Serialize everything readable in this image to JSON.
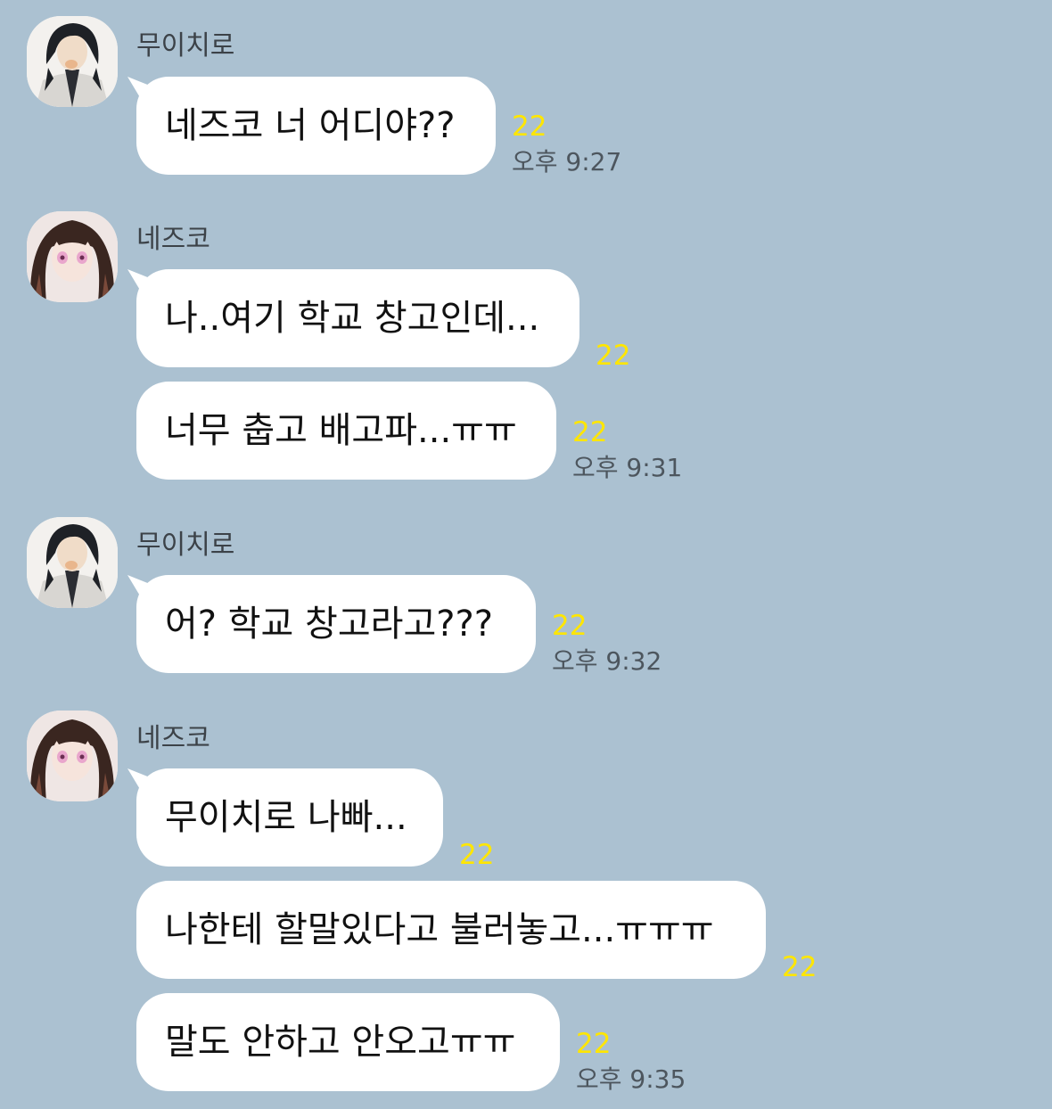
{
  "theme": {
    "background": "#abc1d1",
    "bubble": "#ffffff",
    "unread_color": "#ffe600",
    "meta_text": "#4d565e"
  },
  "groups": [
    {
      "sender": "무이치로",
      "avatar_icon": "muichiro-avatar-icon",
      "messages": [
        {
          "text": "네즈코 너 어디야??",
          "unread": "22",
          "time": "오후 9:27"
        }
      ]
    },
    {
      "sender": "네즈코",
      "avatar_icon": "nezuko-avatar-icon",
      "messages": [
        {
          "text": "나..여기 학교 창고인데...",
          "unread": "22"
        },
        {
          "text": "너무 춥고 배고파...ㅠㅠ",
          "unread": "22",
          "time": "오후 9:31"
        }
      ]
    },
    {
      "sender": "무이치로",
      "avatar_icon": "muichiro-avatar-icon",
      "messages": [
        {
          "text": "어? 학교 창고라고???",
          "unread": "22",
          "time": "오후 9:32"
        }
      ]
    },
    {
      "sender": "네즈코",
      "avatar_icon": "nezuko-avatar-icon",
      "messages": [
        {
          "text": "무이치로 나빠...",
          "unread": "22"
        },
        {
          "text": "나한테 할말있다고 불러놓고...ㅠㅠㅠ",
          "unread": "22"
        },
        {
          "text": "말도 안하고 안오고ㅠㅠ",
          "unread": "22",
          "time": "오후 9:35"
        }
      ]
    }
  ]
}
